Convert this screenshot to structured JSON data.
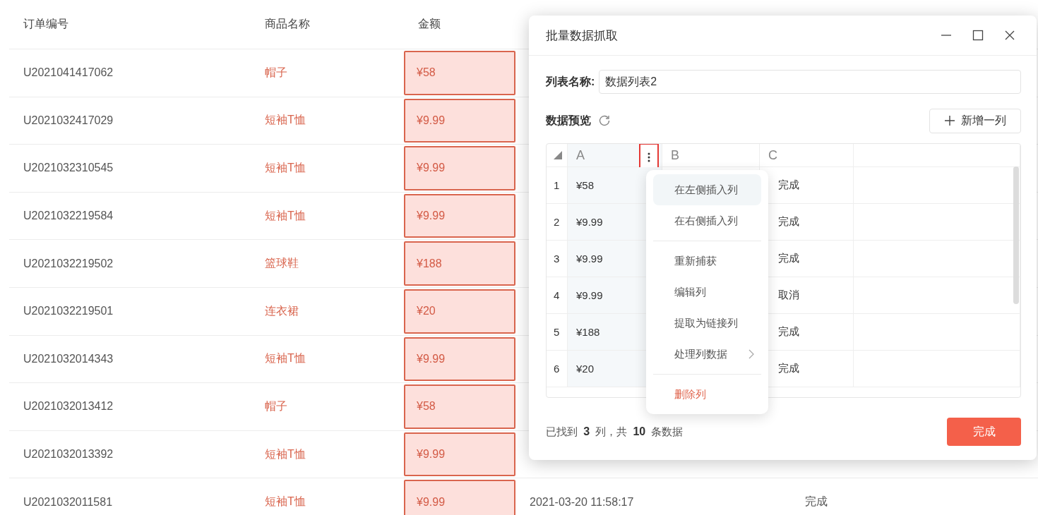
{
  "page_table": {
    "columns": [
      "订单编号",
      "商品名称",
      "金额"
    ],
    "rows": [
      {
        "order_id": "U2021041417062",
        "product": "帽子",
        "amount": "¥58",
        "highlighted": true
      },
      {
        "order_id": "U2021032417029",
        "product": "短袖T恤",
        "amount": "¥9.99",
        "highlighted": true
      },
      {
        "order_id": "U2021032310545",
        "product": "短袖T恤",
        "amount": "¥9.99",
        "highlighted": true
      },
      {
        "order_id": "U2021032219584",
        "product": "短袖T恤",
        "amount": "¥9.99",
        "highlighted": true
      },
      {
        "order_id": "U2021032219502",
        "product": "篮球鞋",
        "amount": "¥188",
        "highlighted": true
      },
      {
        "order_id": "U2021032219501",
        "product": "连衣裙",
        "amount": "¥20",
        "highlighted": true
      },
      {
        "order_id": "U2021032014343",
        "product": "短袖T恤",
        "amount": "¥9.99",
        "highlighted": true
      },
      {
        "order_id": "U2021032013412",
        "product": "帽子",
        "amount": "¥58",
        "highlighted": true
      },
      {
        "order_id": "U2021032013392",
        "product": "短袖T恤",
        "amount": "¥9.99",
        "highlighted": true
      },
      {
        "order_id": "U2021032011581",
        "product": "短袖T恤",
        "amount": "¥9.99",
        "highlighted": true,
        "time": "2021-03-20 11:58:17",
        "status": "完成"
      }
    ]
  },
  "dialog": {
    "title": "批量数据抓取",
    "list_name": {
      "label": "列表名称:",
      "value": "数据列表2"
    },
    "preview": {
      "title": "数据预览",
      "add_column_button": "新增一列",
      "columns": [
        {
          "label": "A",
          "selected": true
        },
        {
          "label": "B",
          "selected": false
        },
        {
          "label": "C",
          "selected": false
        }
      ],
      "rows": [
        {
          "index": "1",
          "a": "¥58",
          "c": "完成"
        },
        {
          "index": "2",
          "a": "¥9.99",
          "c": "完成"
        },
        {
          "index": "3",
          "a": "¥9.99",
          "c": "完成"
        },
        {
          "index": "4",
          "a": "¥9.99",
          "c": "取消"
        },
        {
          "index": "5",
          "a": "¥188",
          "c": "完成"
        },
        {
          "index": "6",
          "a": "¥20",
          "c": "完成"
        }
      ]
    },
    "context_menu": [
      {
        "kind": "action",
        "label": "在左侧插入列",
        "hovered": true,
        "has_submenu": false
      },
      {
        "kind": "action",
        "label": "在右侧插入列",
        "hovered": false,
        "has_submenu": false
      },
      {
        "kind": "divider"
      },
      {
        "kind": "action",
        "label": "重新捕获",
        "hovered": false,
        "has_submenu": false
      },
      {
        "kind": "action",
        "label": "编辑列",
        "hovered": false,
        "has_submenu": false
      },
      {
        "kind": "action",
        "label": "提取为链接列",
        "hovered": false,
        "has_submenu": false
      },
      {
        "kind": "action",
        "label": "处理列数据",
        "hovered": false,
        "has_submenu": true
      },
      {
        "kind": "divider"
      },
      {
        "kind": "danger",
        "label": "删除列",
        "hovered": false,
        "has_submenu": false
      }
    ],
    "summary": "已找到 **3** 列，共 **10** 条数据",
    "done_button": "完成"
  }
}
